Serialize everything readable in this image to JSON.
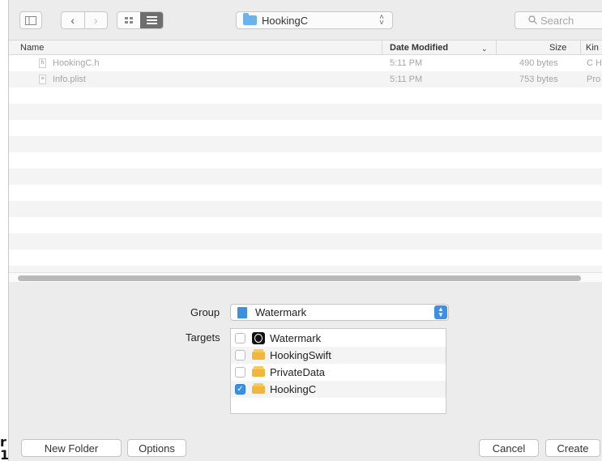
{
  "toolbar": {
    "path_label": "HookingC",
    "search_placeholder": "Search"
  },
  "columns": {
    "name": "Name",
    "date_modified": "Date Modified",
    "size": "Size",
    "kind": "Kin"
  },
  "files": [
    {
      "icon_glyph": "h",
      "name": "HookingC.h",
      "date": "5:11 PM",
      "size": "490 bytes",
      "kind": "C H"
    },
    {
      "icon_glyph": "≡",
      "name": "Info.plist",
      "date": "5:11 PM",
      "size": "753 bytes",
      "kind": "Pro"
    }
  ],
  "group": {
    "label": "Group",
    "value": "Watermark"
  },
  "targets": {
    "label": "Targets",
    "items": [
      {
        "name": "Watermark",
        "checked": false,
        "icon": "app-icon"
      },
      {
        "name": "HookingSwift",
        "checked": false,
        "icon": "framework-icon"
      },
      {
        "name": "PrivateData",
        "checked": false,
        "icon": "framework-icon"
      },
      {
        "name": "HookingC",
        "checked": true,
        "icon": "framework-icon"
      }
    ]
  },
  "buttons": {
    "new_folder": "New Folder",
    "options": "Options",
    "cancel": "Cancel",
    "create": "Create"
  },
  "colors": {
    "accent": "#3b8fe8",
    "folder": "#6bb3ea",
    "framework": "#f0b73a"
  }
}
